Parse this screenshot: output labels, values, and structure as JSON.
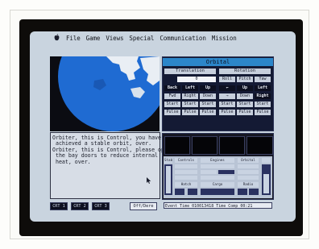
{
  "menu": {
    "items": [
      "File",
      "Game",
      "Views",
      "Special",
      "Communication",
      "Mission"
    ]
  },
  "orbital": {
    "title": "Orbital",
    "translation_label": "Translation",
    "rotation_label": "Rotation",
    "translation_value": "0",
    "rotation_axes": [
      "Roll",
      "Pitch",
      "Yaw"
    ],
    "left_headers": [
      "Back",
      "Left",
      "Up"
    ],
    "left_rows": [
      [
        "Fwd",
        "Right",
        "Down"
      ],
      [
        "Start",
        "Start",
        "Start"
      ],
      [
        "Pulse",
        "Pulse",
        "Pulse"
      ]
    ],
    "right_headers": [
      "←",
      "Up",
      "Left"
    ],
    "right_rows": [
      [
        "→",
        "Down",
        "Right"
      ],
      [
        "Start",
        "Start",
        "Start"
      ],
      [
        "Pulse",
        "Pulse",
        "Pulse"
      ]
    ]
  },
  "comm": {
    "lines": [
      "Orbiter, this is Control, you have",
      " achieved a stable orbit, over.",
      "Orbiter, this is Control, please open",
      " the bay doors to reduce internal",
      " heat, over."
    ]
  },
  "systems": {
    "labels": [
      "Stabilizers",
      "Controls",
      "Engines",
      "Hatch",
      "Cargo",
      "Orbital",
      "Radio"
    ]
  },
  "bottom": {
    "crt_buttons": [
      "CRT 1",
      "CRT 2",
      "CRT 3"
    ],
    "status_label": "Off/Dere",
    "event_line": "Event Time  010013418  Time Comp  00:21"
  },
  "colors": {
    "screen": "#c9d4df",
    "panel_dark": "#141a34",
    "title_blue": "#2c86c9",
    "earth_blue": "#1f6bd2"
  }
}
